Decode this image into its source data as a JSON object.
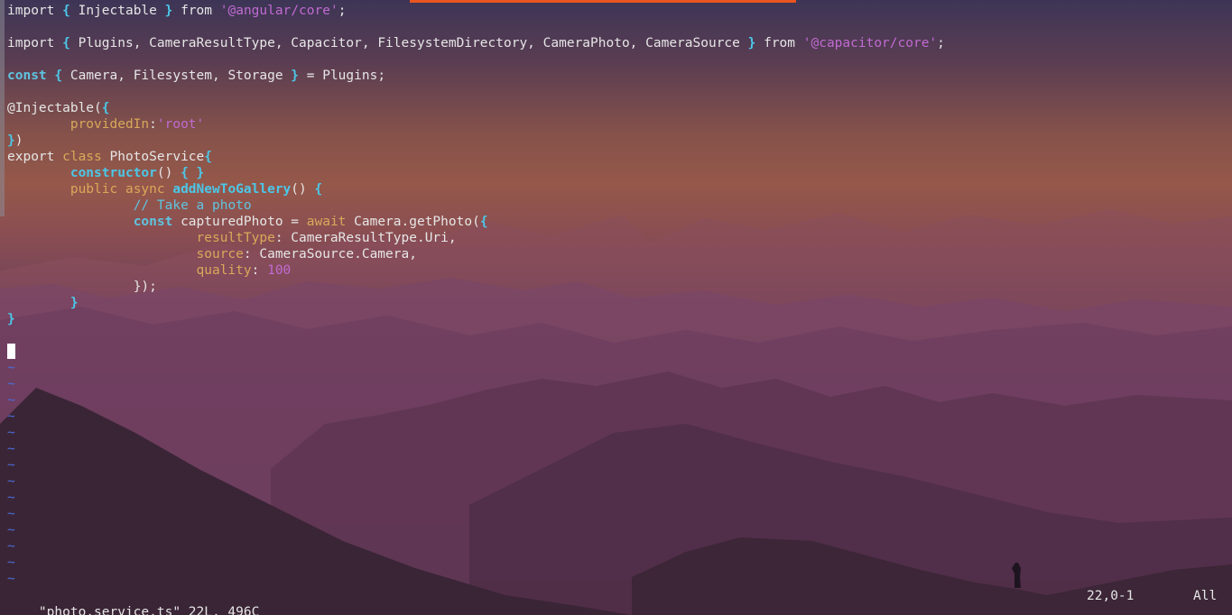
{
  "colors": {
    "accent_bar": "#e95420",
    "keyword": "#d9a85a",
    "brace": "#4cc7e8",
    "string": "#c06bd1",
    "tilde": "#4a6dd8",
    "text": "#e6e6e6"
  },
  "code": {
    "line1": {
      "import": "import",
      "lbrace": "{",
      "name": " Injectable ",
      "rbrace": "}",
      "from": " from ",
      "module": "'@angular/core'",
      "semi": ";"
    },
    "line3": {
      "import": "import",
      "lbrace": "{",
      "names": " Plugins, CameraResultType, Capacitor, FilesystemDirectory, CameraPhoto, CameraSource ",
      "rbrace": "}",
      "from": " from ",
      "module": "'@capacitor/core'",
      "semi": ";"
    },
    "line5": {
      "const": "const",
      "lbrace": "{",
      "names": " Camera, Filesystem, Storage ",
      "rbrace": "}",
      "rest": " = Plugins;"
    },
    "line7": {
      "decorator": "@Injectable(",
      "lbrace": "{"
    },
    "line8": {
      "indent": "        ",
      "prop": "providedIn",
      "colon": ":",
      "value": "'root'"
    },
    "line9": {
      "rbrace": "}",
      "paren": ")"
    },
    "line10": {
      "export": "export ",
      "class": "class",
      "name": " PhotoService",
      "lbrace": "{"
    },
    "line11": {
      "indent": "        ",
      "ctor": "constructor",
      "parens": "() ",
      "braces": "{ }"
    },
    "line12": {
      "indent": "        ",
      "public": "public",
      "async": " async ",
      "fn": "addNewToGallery",
      "parens": "() ",
      "lbrace": "{"
    },
    "line13": {
      "indent": "                ",
      "comment": "// Take a photo"
    },
    "line14": {
      "indent": "                ",
      "const": "const",
      "name": " capturedPhoto = ",
      "await": "await",
      "call": " Camera.getPhoto(",
      "lbrace": "{"
    },
    "line15": {
      "indent": "                        ",
      "prop": "resultType",
      "rest": ": CameraResultType.Uri,"
    },
    "line16": {
      "indent": "                        ",
      "prop": "source",
      "rest": ": CameraSource.Camera,"
    },
    "line17": {
      "indent": "                        ",
      "prop": "quality",
      "colon": ": ",
      "value": "100"
    },
    "line18": {
      "indent": "                ",
      "rbrace": "}",
      "rest": ");"
    },
    "line19": {
      "indent": "        ",
      "rbrace": "}"
    },
    "line20": {
      "rbrace": "}"
    },
    "tilde": "~"
  },
  "status": {
    "file_info": "\"photo.service.ts\" 22L, 496C",
    "position": "22,0-1",
    "scope": "All"
  }
}
